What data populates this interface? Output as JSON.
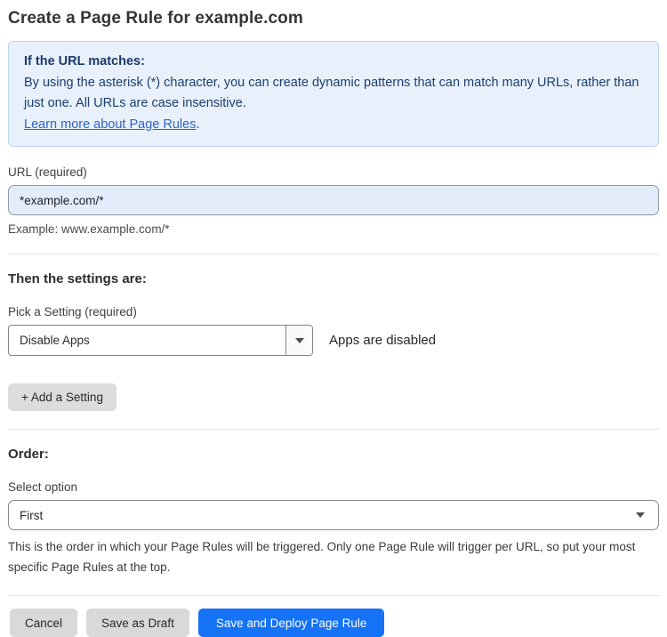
{
  "page": {
    "title": "Create a Page Rule for example.com"
  },
  "info_box": {
    "heading": "If the URL matches:",
    "body": "By using the asterisk (*) character, you can create dynamic patterns that can match many URLs, rather than just one. All URLs are case insensitive.",
    "link_label": "Learn more about Page Rules",
    "link_suffix": "."
  },
  "url_field": {
    "label": "URL (required)",
    "value": "*example.com/*",
    "example": "Example: www.example.com/*"
  },
  "settings_section": {
    "heading": "Then the settings are:",
    "pick_label": "Pick a Setting (required)",
    "selected_setting": "Disable Apps",
    "status_text": "Apps are disabled",
    "add_button_label": "+ Add a Setting"
  },
  "order_section": {
    "heading": "Order:",
    "label": "Select option",
    "selected_option": "First",
    "help_text": "This is the order in which your Page Rules will be triggered. Only one Page Rule will trigger per URL, so put your most specific Page Rules at the top."
  },
  "footer": {
    "cancel_label": "Cancel",
    "save_draft_label": "Save as Draft",
    "save_deploy_label": "Save and Deploy Page Rule"
  },
  "icons": {
    "setting_dropdown": "chevron-down-icon",
    "order_dropdown": "chevron-down-icon"
  },
  "colors": {
    "primary_button_blue": "#1672f6",
    "info_box_background": "#e8f1fb",
    "info_box_border": "#bcd3ee",
    "info_box_text": "#1e3d6f",
    "link_blue": "#2f63c6",
    "url_input_background": "#e2ecfa",
    "gray_button": "#d9d9da"
  }
}
